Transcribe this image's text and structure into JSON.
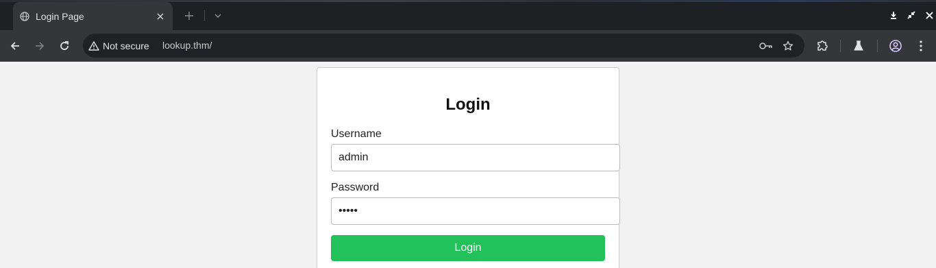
{
  "browser": {
    "tab": {
      "title": "Login Page",
      "favicon": "globe-icon"
    },
    "address_bar": {
      "security_label": "Not secure",
      "url": "lookup.thm/"
    },
    "icons": {
      "back": "back-arrow-icon",
      "forward": "forward-arrow-icon",
      "reload": "reload-icon",
      "warning": "warning-icon",
      "password_key": "key-icon",
      "bookmark": "star-icon",
      "extensions": "puzzle-icon",
      "labs": "flask-icon",
      "profile": "profile-icon",
      "menu": "kebab-menu-icon"
    }
  },
  "page": {
    "title": "Login",
    "username_label": "Username",
    "username_value": "admin",
    "password_label": "Password",
    "password_value": "admin",
    "submit_label": "Login"
  },
  "colors": {
    "button": "#22c15a",
    "page_background": "#f2f2f2",
    "chrome_dark": "#1f2023",
    "toolbar": "#35363a"
  }
}
